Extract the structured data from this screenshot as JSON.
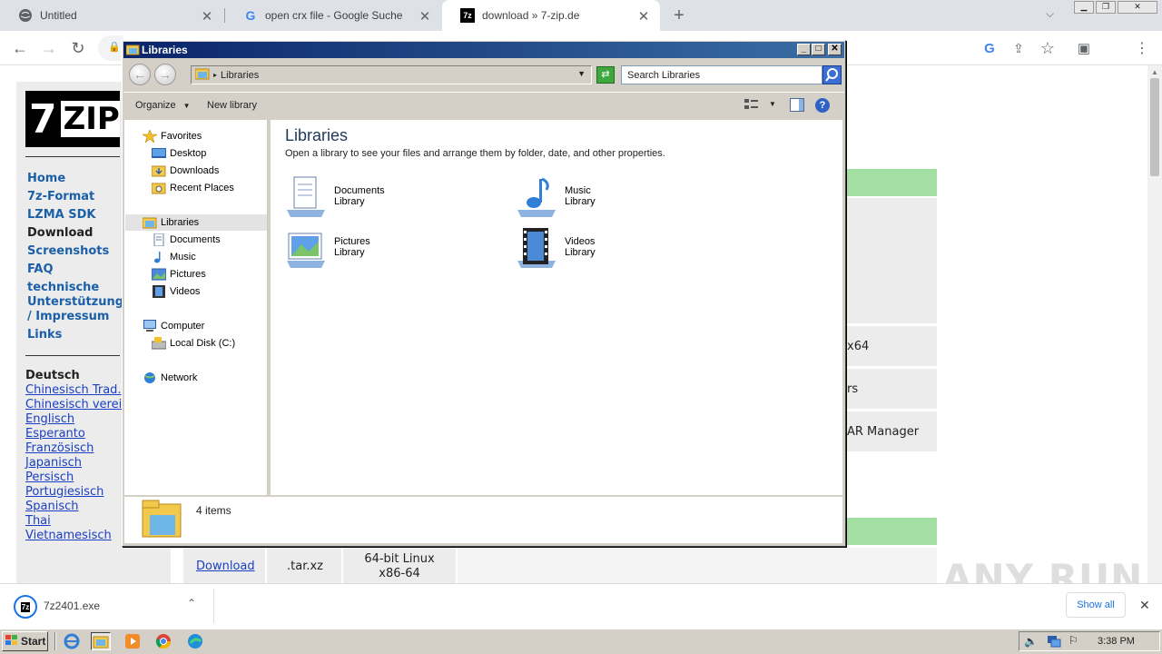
{
  "browser": {
    "tabs": [
      {
        "label": "Untitled"
      },
      {
        "label": "open crx file - Google Suche"
      },
      {
        "label": "download » 7-zip.de"
      }
    ],
    "new_tab": "+"
  },
  "site": {
    "logo": {
      "seven": "7",
      "zip": "ZIP"
    },
    "nav": [
      "Home",
      "7z-Format",
      "LZMA SDK",
      "Download",
      "Screenshots",
      "FAQ",
      "technische",
      "Unterstützung",
      "/ Impressum",
      "Links"
    ],
    "lang_heading": "Deutsch",
    "languages": [
      "Chinesisch Trad.",
      "Chinesisch verei",
      "Englisch",
      "Esperanto",
      "Französisch",
      "Japanisch",
      "Persisch",
      "Portugiesisch",
      "Spanisch",
      "Thai",
      "Vietnamesisch"
    ],
    "cells": {
      "x64": "x64",
      "rs": "rs",
      "ar_manager": "AR Manager"
    },
    "table_row": {
      "link": "Download",
      "type": ".tar.xz",
      "platform_line1": "64-bit Linux",
      "platform_line2": "x86-64"
    }
  },
  "explorer": {
    "title": "Libraries",
    "address": "Libraries",
    "search_placeholder": "Search Libraries",
    "toolbar": {
      "organize": "Organize",
      "new_library": "New library"
    },
    "nav": {
      "favorites": "Favorites",
      "fav_items": [
        "Desktop",
        "Downloads",
        "Recent Places"
      ],
      "libraries": "Libraries",
      "lib_items": [
        "Documents",
        "Music",
        "Pictures",
        "Videos"
      ],
      "computer": "Computer",
      "comp_items": [
        "Local Disk (C:)"
      ],
      "network": "Network"
    },
    "heading": "Libraries",
    "subheading": "Open a library to see your files and arrange them by folder, date, and other properties.",
    "libraries": [
      {
        "name": "Documents",
        "type": "Library"
      },
      {
        "name": "Music",
        "type": "Library"
      },
      {
        "name": "Pictures",
        "type": "Library"
      },
      {
        "name": "Videos",
        "type": "Library"
      }
    ],
    "status": "4 items"
  },
  "download_bar": {
    "file": "7z2401.exe",
    "show_all": "Show all"
  },
  "taskbar": {
    "start": "Start",
    "clock": "3:38 PM"
  },
  "watermark": "ANY RUN"
}
